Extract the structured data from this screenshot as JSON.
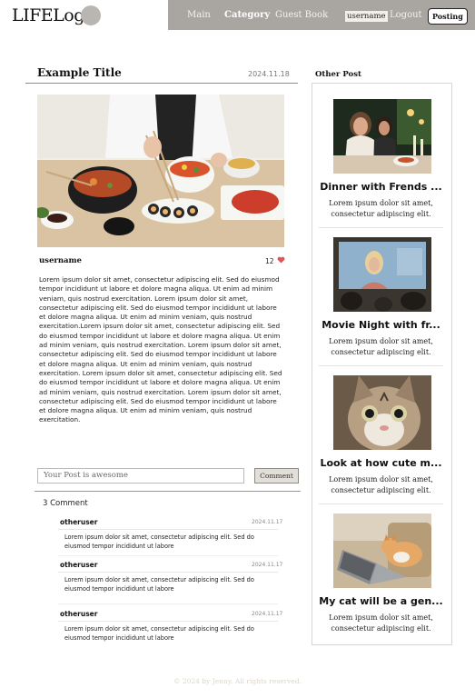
{
  "header": {
    "logo": "LIFELog",
    "nav": {
      "main": "Main",
      "category": "Category",
      "guestbook": "Guest Book",
      "username": "username",
      "logout": "Logout",
      "posting": "Posting"
    }
  },
  "post": {
    "title": "Example Title",
    "date": "2024.11.18",
    "author": "username",
    "likes": "12",
    "body": "Lorem ipsum dolor sit amet, consectetur adipiscing elit. Sed do eiusmod tempor incididunt ut labore et dolore magna aliqua. Ut enim ad minim veniam, quis nostrud exercitation. Lorem ipsum dolor sit amet, consectetur adipiscing elit. Sed do eiusmod tempor incididunt ut labore et dolore magna aliqua. Ut enim ad minim veniam, quis nostrud exercitation.Lorem ipsum dolor sit amet, consectetur adipiscing elit. Sed do eiusmod tempor incididunt ut labore et dolore magna aliqua. Ut enim ad minim veniam, quis nostrud exercitation. Lorem ipsum dolor sit amet, consectetur adipiscing elit. Sed do eiusmod tempor incididunt ut labore et dolore magna aliqua. Ut enim ad minim veniam, quis nostrud exercitation. Lorem ipsum dolor sit amet, consectetur adipiscing elit. Sed do eiusmod tempor incididunt ut labore et dolore magna aliqua. Ut enim ad minim veniam, quis nostrud exercitation. Lorem ipsum dolor sit amet, consectetur adipiscing elit. Sed do eiusmod tempor incididunt ut labore et dolore magna aliqua. Ut enim ad minim veniam, quis nostrud exercitation."
  },
  "comment_form": {
    "placeholder": "Your Post is awesome",
    "button": "Comment"
  },
  "comments_header": "3 Comment",
  "comments": [
    {
      "user": "otheruser",
      "date": "2024.11.17",
      "text": "Lorem ipsum dolor sit amet, consectetur adipiscing elit. Sed do eiusmod tempor incididunt ut labore"
    },
    {
      "user": "otheruser",
      "date": "2024.11.17",
      "text": "Lorem ipsum dolor sit amet, consectetur adipiscing elit. Sed do eiusmod tempor incididunt ut labore"
    },
    {
      "user": "otheruser",
      "date": "2024.11.17",
      "text": "Lorem ipsum dolor sit amet, consectetur adipiscing elit. Sed do eiusmod tempor incididunt ut labore"
    }
  ],
  "sidebar": {
    "title": "Other Post",
    "posts": [
      {
        "title": "Dinner with Frends ...",
        "desc": "Lorem ipsum dolor sit amet, consectetur adipiscing elit."
      },
      {
        "title": "Movie Night with fr...",
        "desc": "Lorem ipsum dolor sit amet, consectetur adipiscing elit."
      },
      {
        "title": "Look at how cute m...",
        "desc": "Lorem ipsum dolor sit amet, consectetur adipiscing elit."
      },
      {
        "title": "My cat will be a gen...",
        "desc": "Lorem ipsum dolor sit amet, consectetur adipiscing elit."
      }
    ]
  },
  "footer": "© 2024 by Jenny. All rights reserved.",
  "colors": {
    "nav_bg": "#a9a6a2",
    "heart": "#e05555",
    "button_bg": "#e2ded8"
  },
  "icons": [
    "heart-icon"
  ]
}
